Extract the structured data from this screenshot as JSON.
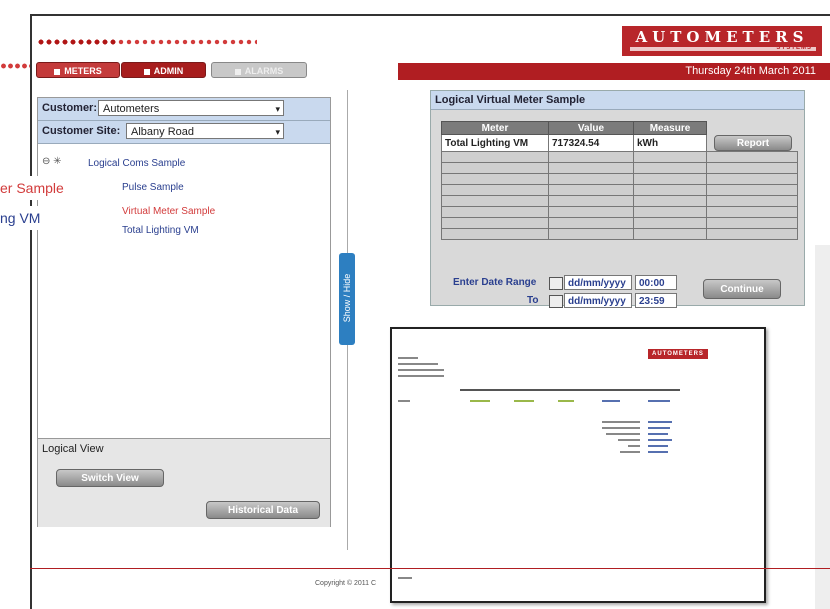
{
  "header": {
    "logo_text": "AUTOMETERS",
    "logo_sub": "SYSTEMS",
    "date": "Thursday 24th March 2011",
    "tabs": [
      {
        "label": "METERS"
      },
      {
        "label": "ADMIN"
      },
      {
        "label": "ALARMS"
      }
    ]
  },
  "sidebar": {
    "customer_label": "Customer:",
    "customer_value": "Autometers",
    "site_label": "Customer Site:",
    "site_value": "Albany Road",
    "tree": [
      {
        "label": "Logical Coms Sample"
      },
      {
        "label": "Pulse Sample"
      },
      {
        "label": "Virtual Meter Sample"
      },
      {
        "label": "Total Lighting VM"
      }
    ],
    "logical_view_label": "Logical View",
    "switch_view": "Switch View",
    "historical_data": "Historical Data"
  },
  "callouts": {
    "first": "er Sample",
    "second": "ng VM"
  },
  "show_hide": "Show / Hide",
  "panel": {
    "title": "Logical Virtual Meter Sample",
    "columns": [
      "Meter",
      "Value",
      "Measure"
    ],
    "row": {
      "meter": "Total Lighting VM",
      "value": "717324.54",
      "measure": "kWh"
    },
    "report_button": "Report",
    "date_range_label": "Enter Date Range",
    "to_label": "To",
    "from_date": "dd/mm/yyyy",
    "from_time": "00:00",
    "to_date": "dd/mm/yyyy",
    "to_time": "23:59",
    "continue_button": "Continue"
  },
  "report": {
    "logo": "AUTOMETERS"
  },
  "footer": {
    "copyright": "Copyright © 2011 C"
  },
  "colors": {
    "brand_red": "#b01e22",
    "header_blue": "#c9d9ee",
    "show_hide_blue": "#2d7fc1"
  }
}
